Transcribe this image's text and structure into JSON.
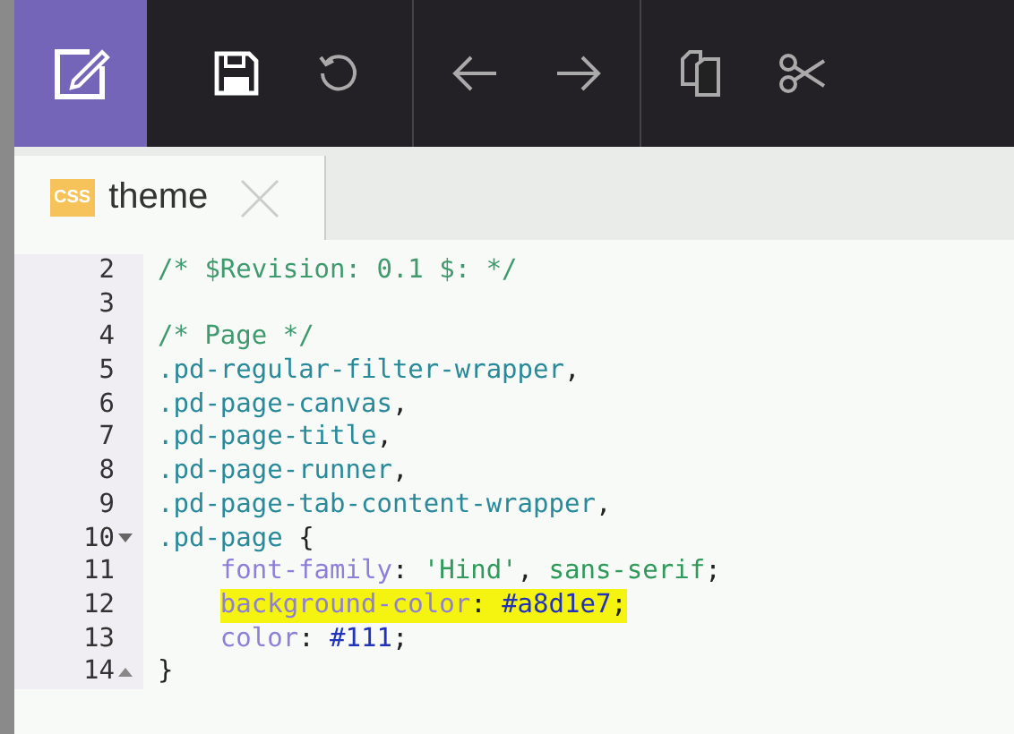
{
  "toolbar": {
    "groups": [
      [
        {
          "kind": "save"
        },
        {
          "kind": "undo"
        }
      ],
      [
        {
          "kind": "back"
        },
        {
          "kind": "forward"
        }
      ],
      [
        {
          "kind": "copy"
        },
        {
          "kind": "cut"
        }
      ]
    ]
  },
  "tabs": [
    {
      "label": "theme",
      "badge": "CSS",
      "selected": true
    }
  ],
  "lines": [
    {
      "number": "2",
      "highlighted": false,
      "tokens": [
        {
          "kind": "comment",
          "text": "/* $Revision: 0.1 $: */"
        }
      ]
    },
    {
      "number": "3",
      "highlighted": false
    },
    {
      "number": "4",
      "highlighted": false,
      "tokens": [
        {
          "kind": "comment",
          "text": "/* Page */"
        }
      ]
    },
    {
      "number": "5",
      "highlighted": false,
      "tokens": [
        {
          "kind": "selector",
          "text": ".pd-regular-filter-wrapper"
        },
        {
          "kind": "punct",
          "text": ","
        }
      ]
    },
    {
      "number": "6",
      "highlighted": false,
      "tokens": [
        {
          "kind": "selector",
          "text": ".pd-page-canvas"
        },
        {
          "kind": "punct",
          "text": ","
        }
      ]
    },
    {
      "number": "7",
      "highlighted": false,
      "tokens": [
        {
          "kind": "selector",
          "text": ".pd-page-title"
        },
        {
          "kind": "punct",
          "text": ","
        }
      ]
    },
    {
      "number": "8",
      "highlighted": false,
      "tokens": [
        {
          "kind": "selector",
          "text": ".pd-page-runner"
        },
        {
          "kind": "punct",
          "text": ","
        }
      ]
    },
    {
      "number": "9",
      "highlighted": false,
      "tokens": [
        {
          "kind": "selector",
          "text": ".pd-page-tab-content-wrapper"
        },
        {
          "kind": "punct",
          "text": ","
        }
      ]
    },
    {
      "number": "10",
      "fold": {
        "kind": "open"
      },
      "highlighted": false,
      "tokens": [
        {
          "kind": "selector",
          "text": ".pd-page"
        },
        {
          "kind": "punct",
          "text": " {"
        }
      ]
    },
    {
      "number": "11",
      "indent": true,
      "highlighted": false,
      "tokens": [
        {
          "kind": "property",
          "text": "font-family"
        },
        {
          "kind": "punct",
          "text": ": "
        },
        {
          "kind": "string",
          "text": "'Hind'"
        },
        {
          "kind": "punct",
          "text": ", "
        },
        {
          "kind": "string",
          "text": "sans-serif"
        },
        {
          "kind": "punct",
          "text": ";"
        }
      ]
    },
    {
      "number": "12",
      "indent": true,
      "highlighted": true,
      "tokens": [
        {
          "kind": "property",
          "text": "background-color"
        },
        {
          "kind": "punct",
          "text": ": "
        },
        {
          "kind": "value",
          "text": "#a8d1e7"
        },
        {
          "kind": "punct",
          "text": ";"
        }
      ]
    },
    {
      "number": "13",
      "indent": true,
      "highlighted": false,
      "tokens": [
        {
          "kind": "property",
          "text": "color"
        },
        {
          "kind": "punct",
          "text": ": "
        },
        {
          "kind": "value",
          "text": "#111"
        },
        {
          "kind": "punct",
          "text": ";"
        }
      ]
    },
    {
      "number": "14",
      "fold": {
        "kind": "close"
      },
      "highlighted": false,
      "tokens": [
        {
          "kind": "punct",
          "text": "}"
        }
      ]
    }
  ]
}
